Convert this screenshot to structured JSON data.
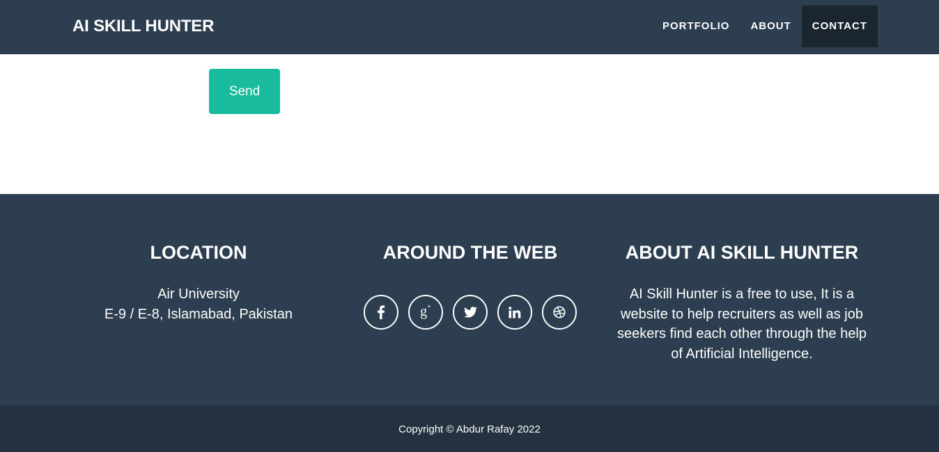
{
  "navbar": {
    "brand": "AI SKILL HUNTER",
    "items": [
      {
        "label": "PORTFOLIO"
      },
      {
        "label": "ABOUT"
      },
      {
        "label": "CONTACT",
        "active": true
      }
    ]
  },
  "form": {
    "send_label": "Send"
  },
  "footer": {
    "location": {
      "heading": "LOCATION",
      "line1": "Air University",
      "line2": "E-9 / E-8, Islamabad, Pakistan"
    },
    "web": {
      "heading": "AROUND THE WEB",
      "icons": [
        "facebook-icon",
        "google-plus-icon",
        "twitter-icon",
        "linkedin-icon",
        "dribbble-icon"
      ]
    },
    "about": {
      "heading": "ABOUT AI SKILL HUNTER",
      "text": "AI Skill Hunter is a free to use, It is a website to help recruiters as well as job seekers find each other through the help of Artificial Intelligence."
    },
    "copyright": "Copyright © Abdur Rafay 2022"
  },
  "colors": {
    "primary": "#2c3e50",
    "accent": "#18bc9c",
    "active_nav": "#1a252f",
    "copyright_bg": "#233140"
  }
}
